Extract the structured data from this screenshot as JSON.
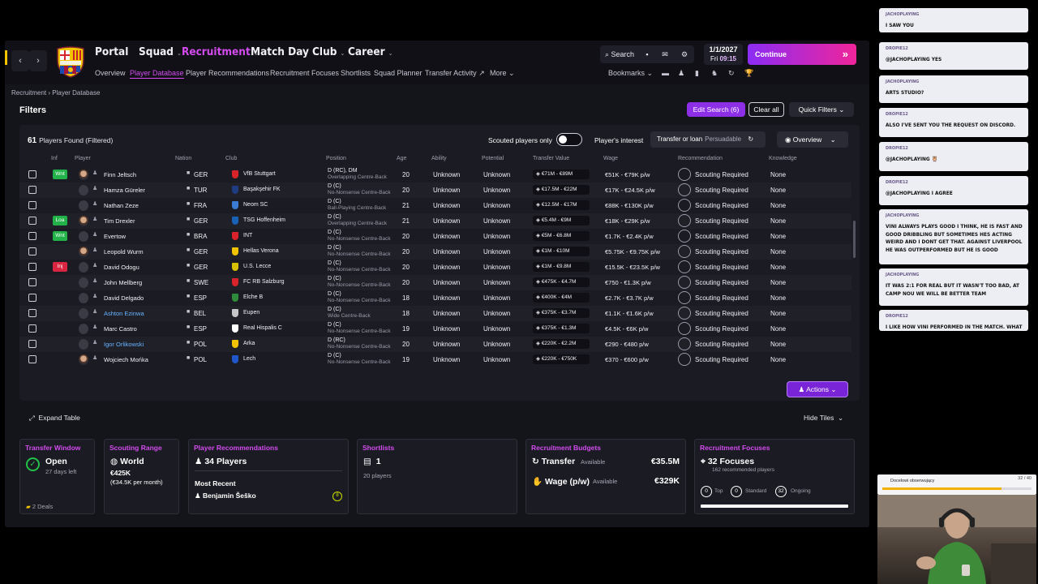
{
  "nav": {
    "main": [
      {
        "label": "Portal",
        "active": false
      },
      {
        "label": "Squad",
        "active": false
      },
      {
        "label": "Recruitment",
        "active": true
      },
      {
        "label": "Match Day",
        "active": false
      },
      {
        "label": "Club",
        "active": false
      },
      {
        "label": "Career",
        "active": false
      }
    ],
    "sub": [
      {
        "label": "Overview",
        "active": false
      },
      {
        "label": "Player Database",
        "active": true
      },
      {
        "label": "Player Recommendations",
        "active": false
      },
      {
        "label": "Recruitment Focuses",
        "active": false
      },
      {
        "label": "Shortlists",
        "active": false
      },
      {
        "label": "Squad Planner",
        "active": false
      },
      {
        "label": "Transfer Activity",
        "active": false
      },
      {
        "label": "More",
        "active": false
      }
    ],
    "search_label": "Search",
    "bookmarks_label": "Bookmarks",
    "date": "1/1/2027",
    "day": "Fri",
    "time": "09:15",
    "continue_label": "Continue"
  },
  "breadcrumb": {
    "root": "Recruitment",
    "current": "Player Database"
  },
  "filters": {
    "title": "Filters",
    "edit_search": "Edit Search (6)",
    "clear_all": "Clear all",
    "quick_filters": "Quick Filters"
  },
  "table": {
    "found_count": "61",
    "found_label": "Players Found (Filtered)",
    "scouted_only_label": "Scouted players only",
    "scouted_only_on": false,
    "interest_label": "Player's interest",
    "interest_value": "Transfer or loan",
    "interest_extra": "Persuadable",
    "view_label": "Overview",
    "headers": [
      "Inf",
      "Player",
      "Nation",
      "Club",
      "Position",
      "Age",
      "Ability",
      "Potential",
      "Transfer Value",
      "Wage",
      "Recommendation",
      "Knowledge"
    ],
    "rows": [
      {
        "inf": "Wnt",
        "inf_color": "green",
        "photo": true,
        "name": "Finn Jeltsch",
        "nation": "GER",
        "club": "VfB Stuttgart",
        "club_color": "#d8232a",
        "pos": "D (RC), DM",
        "role": "Overlapping Centre-Back",
        "age": "20",
        "ability": "Unknown",
        "potential": "Unknown",
        "value": "€71M - €89M",
        "wage": "€51K - €79K p/w",
        "rec": "Scouting Required",
        "knowledge": "None"
      },
      {
        "inf": "",
        "inf_color": "",
        "photo": false,
        "name": "Hamza Güreler",
        "nation": "TUR",
        "club": "Başakşehir FK",
        "club_color": "#1f3c80",
        "pos": "D (C)",
        "role": "No-Nonsense Centre-Back",
        "age": "20",
        "ability": "Unknown",
        "potential": "Unknown",
        "value": "€17.5M - €22M",
        "wage": "€17K - €24.5K p/w",
        "rec": "Scouting Required",
        "knowledge": "None"
      },
      {
        "inf": "",
        "inf_color": "",
        "photo": false,
        "name": "Nathan Zeze",
        "nation": "FRA",
        "club": "Neom SC",
        "club_color": "#3a7bd5",
        "pos": "D (C)",
        "role": "Ball-Playing Centre-Back",
        "age": "21",
        "ability": "Unknown",
        "potential": "Unknown",
        "value": "€12.5M - €17M",
        "wage": "€88K - €130K p/w",
        "rec": "Scouting Required",
        "knowledge": "None"
      },
      {
        "inf": "Loa",
        "inf_color": "green",
        "photo": true,
        "name": "Tim Drexler",
        "nation": "GER",
        "club": "TSG Hoffenheim",
        "club_color": "#1961b5",
        "pos": "D (C)",
        "role": "Overlapping Centre-Back",
        "age": "21",
        "ability": "Unknown",
        "potential": "Unknown",
        "value": "€5.4M - €9M",
        "wage": "€18K - €29K p/w",
        "rec": "Scouting Required",
        "knowledge": "None"
      },
      {
        "inf": "Wnt",
        "inf_color": "green",
        "photo": false,
        "name": "Evertow",
        "nation": "BRA",
        "club": "INT",
        "club_color": "#d8232a",
        "pos": "D (C)",
        "role": "No-Nonsense Centre-Back",
        "age": "20",
        "ability": "Unknown",
        "potential": "Unknown",
        "value": "€5M - €6.8M",
        "wage": "€1.7K - €2.4K p/w",
        "rec": "Scouting Required",
        "knowledge": "None"
      },
      {
        "inf": "",
        "inf_color": "",
        "photo": true,
        "name": "Leopold Wurm",
        "nation": "GER",
        "club": "Hellas Verona",
        "club_color": "#f2c400",
        "pos": "D (C)",
        "role": "No-Nonsense Centre-Back",
        "age": "20",
        "ability": "Unknown",
        "potential": "Unknown",
        "value": "€1M - €10M",
        "wage": "€5.75K - €9.75K p/w",
        "rec": "Scouting Required",
        "knowledge": "None"
      },
      {
        "inf": "Inj",
        "inf_color": "red",
        "photo": false,
        "name": "David Odogu",
        "nation": "GER",
        "club": "U.S. Lecce",
        "club_color": "#d8c200",
        "pos": "D (C)",
        "role": "No-Nonsense Centre-Back",
        "age": "20",
        "ability": "Unknown",
        "potential": "Unknown",
        "value": "€1M - €9.8M",
        "wage": "€15.5K - €23.5K p/w",
        "rec": "Scouting Required",
        "knowledge": "None"
      },
      {
        "inf": "",
        "inf_color": "",
        "photo": false,
        "name": "John Mellberg",
        "nation": "SWE",
        "club": "FC RB Salzburg",
        "club_color": "#d8232a",
        "pos": "D (C)",
        "role": "No-Nonsense Centre-Back",
        "age": "20",
        "ability": "Unknown",
        "potential": "Unknown",
        "value": "€475K - €4.7M",
        "wage": "€750 - €1.3K p/w",
        "rec": "Scouting Required",
        "knowledge": "None"
      },
      {
        "inf": "",
        "inf_color": "",
        "photo": false,
        "name": "David Delgado",
        "nation": "ESP",
        "club": "Elche B",
        "club_color": "#2e8b3c",
        "pos": "D (C)",
        "role": "No-Nonsense Centre-Back",
        "age": "18",
        "ability": "Unknown",
        "potential": "Unknown",
        "value": "€400K - €4M",
        "wage": "€2.7K - €3.7K p/w",
        "rec": "Scouting Required",
        "knowledge": "None"
      },
      {
        "inf": "",
        "inf_color": "",
        "photo": false,
        "name": "Ashton Ezinwa",
        "nation": "BEL",
        "club": "Eupen",
        "club_color": "#c7c7c7",
        "pos": "D (C)",
        "role": "Wide Centre-Back",
        "age": "18",
        "ability": "Unknown",
        "potential": "Unknown",
        "value": "€375K - €3.7M",
        "wage": "€1.1K - €1.6K p/w",
        "rec": "Scouting Required",
        "knowledge": "None",
        "blue": true
      },
      {
        "inf": "",
        "inf_color": "",
        "photo": false,
        "name": "Marc Castro",
        "nation": "ESP",
        "club": "Real Hispalis C",
        "club_color": "#ffffff",
        "pos": "D (C)",
        "role": "No-Nonsense Centre-Back",
        "age": "19",
        "ability": "Unknown",
        "potential": "Unknown",
        "value": "€375K - €1.3M",
        "wage": "€4.5K - €6K p/w",
        "rec": "Scouting Required",
        "knowledge": "None"
      },
      {
        "inf": "",
        "inf_color": "",
        "photo": false,
        "name": "Igor Orlikowski",
        "nation": "POL",
        "club": "Arka",
        "club_color": "#f2c400",
        "pos": "D (RC)",
        "role": "No-Nonsense Centre-Back",
        "age": "20",
        "ability": "Unknown",
        "potential": "Unknown",
        "value": "€220K - €2.2M",
        "wage": "€290 - €480 p/w",
        "rec": "Scouting Required",
        "knowledge": "None",
        "blue": true
      },
      {
        "inf": "",
        "inf_color": "",
        "photo": true,
        "name": "Wojciech Mońka",
        "nation": "POL",
        "club": "Lech",
        "club_color": "#1f57c8",
        "pos": "D (C)",
        "role": "No-Nonsense Centre-Back",
        "age": "19",
        "ability": "Unknown",
        "potential": "Unknown",
        "value": "€220K - €750K",
        "wage": "€370 - €600 p/w",
        "rec": "Scouting Required",
        "knowledge": "None"
      }
    ],
    "actions_label": "Actions",
    "expand_label": "Expand Table",
    "hide_tiles_label": "Hide Tiles"
  },
  "tiles": {
    "transfer_window": {
      "title": "Transfer Window",
      "status": "Open",
      "days": "27 days left",
      "deals": "2 Deals"
    },
    "scouting_range": {
      "title": "Scouting Range",
      "range": "World",
      "budget": "€425K",
      "budget_pw": "(€34.5K per month)"
    },
    "recommendations": {
      "title": "Player Recommendations",
      "count": "34 Players",
      "recent_label": "Most Recent",
      "recent_name": "Benjamin Šeško"
    },
    "shortlists": {
      "title": "Shortlists",
      "count": "1",
      "players": "20 players"
    },
    "budgets": {
      "title": "Recruitment Budgets",
      "transfer_label": "Transfer",
      "transfer_avail": "Available",
      "transfer_value": "€35.5M",
      "wage_label": "Wage (p/w)",
      "wage_avail": "Available",
      "wage_value": "€329K"
    },
    "focuses": {
      "title": "Recruitment Focuses",
      "count": "32 Focuses",
      "sub": "162 recommended players",
      "top": "0",
      "top_label": "Top",
      "standard": "0",
      "standard_label": "Standard",
      "ongoing": "32",
      "ongoing_label": "Ongoing"
    }
  },
  "chat": [
    {
      "user": "JACHOPLAYING",
      "msg": "I SAW YOU"
    },
    {
      "user": "DROPIE12",
      "msg": "@JACHOPLAYING YES"
    },
    {
      "user": "JACHOPLAYING",
      "msg": "ARTS STUDIO?"
    },
    {
      "user": "DROPIE12",
      "msg": "ALSO I'VE SENT YOU THE REQUEST ON DISCORD."
    },
    {
      "user": "DROPIE12",
      "msg": "@JACHOPLAYING 🦉"
    },
    {
      "user": "DROPIE12",
      "msg": "@JACHOPLAYING I AGREE"
    },
    {
      "user": "JACHOPLAYING",
      "msg": "VINI ALWAYS PLAYS GOOD I THINK, HE IS FAST AND GOOD DRIBBLING BUT SOMETIMES HES ACTING WEIRD AND I DONT GET THAT. AGAINST LIVERPOOL HE WAS OUTPERFORMED BUT HE IS GOOD"
    },
    {
      "user": "JACHOPLAYING",
      "msg": "IT WAS 2:1 FOR REAL BUT IT WASN'T TOO BAD, AT CAMP NOU WE WILL BE BETTER TEAM"
    },
    {
      "user": "DROPIE12",
      "msg": "I LIKE HOW VINI PERFORMED IN THE MATCH. WHAT"
    }
  ],
  "follow_goal": {
    "label": "Docelowi obserwujący",
    "count": "32 / 40",
    "progress": 0.8
  }
}
